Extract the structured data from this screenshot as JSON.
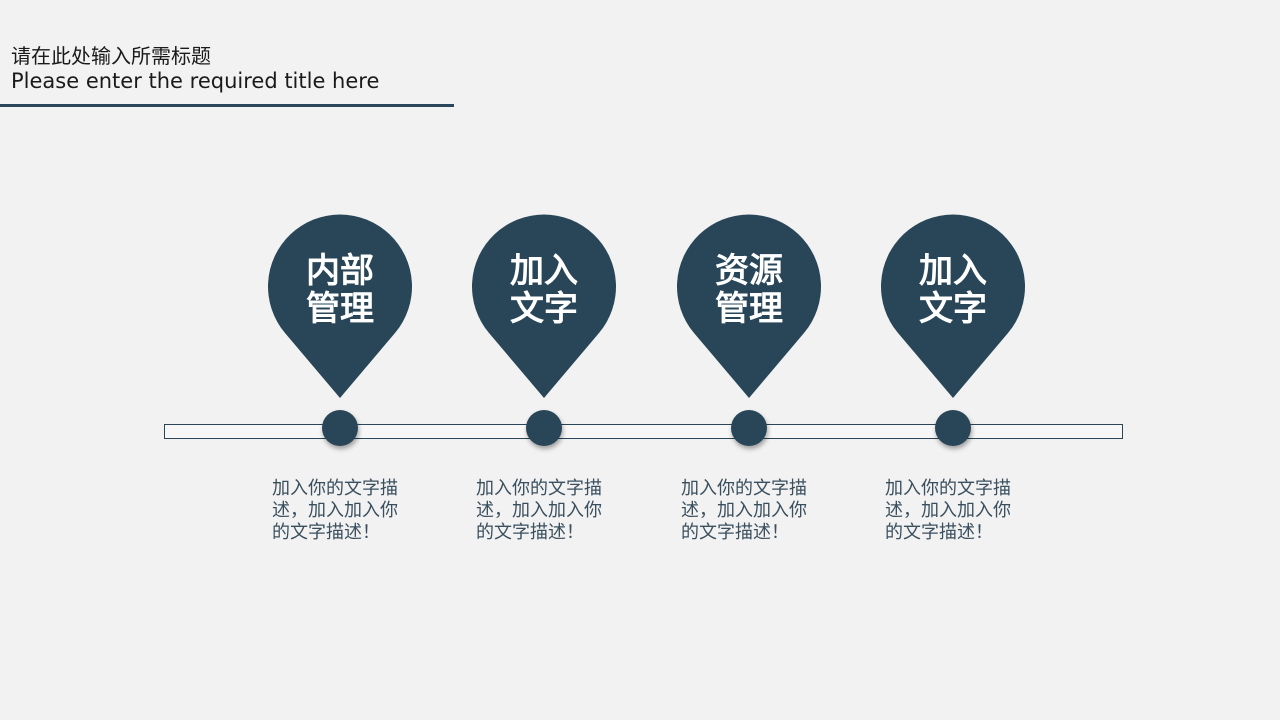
{
  "header": {
    "title_cn": "请在此处输入所需标题",
    "title_en": "Please enter the required title here"
  },
  "colors": {
    "pin_fill": "#294658",
    "background": "#f2f2f2",
    "desc_text": "#3a4f5e"
  },
  "steps": [
    {
      "label_line1": "内部",
      "label_line2": "管理",
      "description": "加入你的文字描\n述，加入加入你\n的文字描述！"
    },
    {
      "label_line1": "加入",
      "label_line2": "文字",
      "description": "加入你的文字描\n述，加入加入你\n的文字描述！"
    },
    {
      "label_line1": "资源",
      "label_line2": "管理",
      "description": "加入你的文字描\n述，加入加入你\n的文字描述！"
    },
    {
      "label_line1": "加入",
      "label_line2": "文字",
      "description": "加入你的文字描\n述，加入加入你\n的文字描述！"
    }
  ]
}
